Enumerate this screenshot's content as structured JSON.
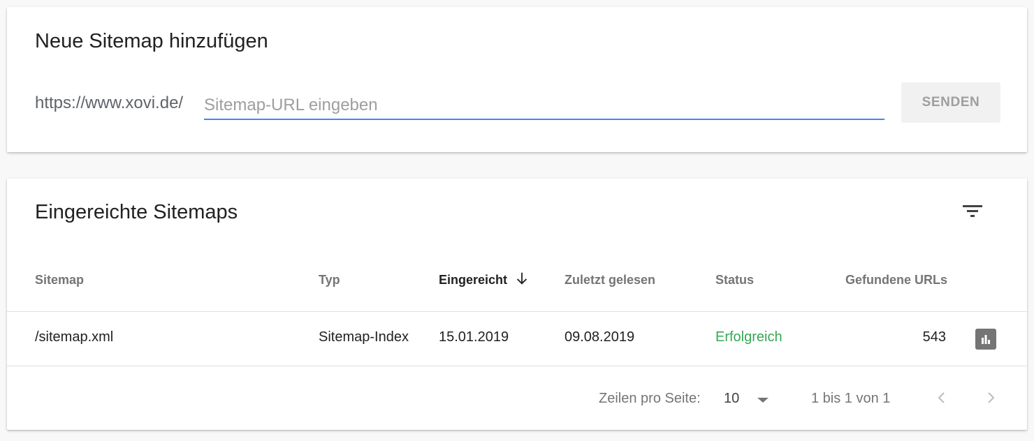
{
  "add_sitemap": {
    "title": "Neue Sitemap hinzufügen",
    "url_prefix": "https://www.xovi.de/",
    "input_value": "",
    "input_placeholder": "Sitemap-URL eingeben",
    "submit_label": "SENDEN"
  },
  "submitted": {
    "title": "Eingereichte Sitemaps",
    "filter_icon": "filter-list-icon",
    "columns": {
      "sitemap": "Sitemap",
      "type": "Typ",
      "submitted": "Eingereicht",
      "last_read": "Zuletzt gelesen",
      "status": "Status",
      "found_urls": "Gefundene URLs"
    },
    "sort": {
      "column": "submitted",
      "direction": "descending",
      "icon": "arrow-downward-icon"
    },
    "rows": [
      {
        "sitemap": "/sitemap.xml",
        "type": "Sitemap-Index",
        "submitted": "15.01.2019",
        "last_read": "09.08.2019",
        "status": "Erfolgreich",
        "found_urls": "543",
        "action_icon": "bar-chart-icon"
      }
    ],
    "pagination": {
      "rows_per_page_label": "Zeilen pro Seite:",
      "rows_per_page_value": "10",
      "range_text": "1 bis 1 von 1",
      "prev_icon": "chevron-left-icon",
      "next_icon": "chevron-right-icon"
    }
  },
  "colors": {
    "accent": "#4285f4",
    "success": "#34a853",
    "muted": "#757575",
    "background": "#f8f8f8"
  }
}
